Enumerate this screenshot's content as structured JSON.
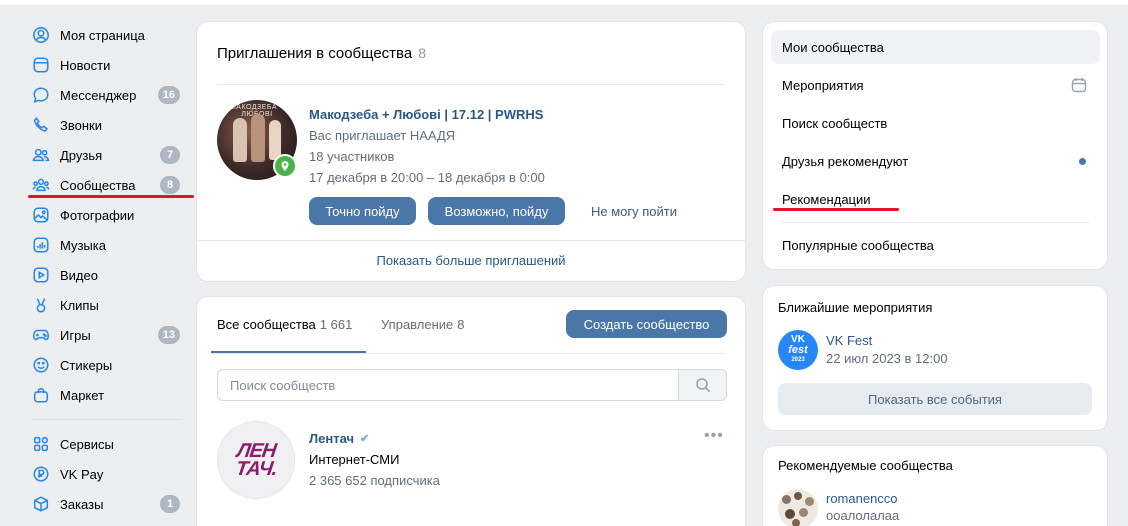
{
  "colors": {
    "accent": "#4a76a8",
    "link": "#2a5885",
    "badge": "#aeb7c2",
    "annotation_red": "#e0142b",
    "page_bg": "#edeef0"
  },
  "nav": {
    "items": [
      {
        "label": "Моя страница",
        "icon": "user-circle-icon"
      },
      {
        "label": "Новости",
        "icon": "news-icon"
      },
      {
        "label": "Мессенджер",
        "icon": "chat-bubble-icon",
        "badge": "16"
      },
      {
        "label": "Звонки",
        "icon": "phone-icon"
      },
      {
        "label": "Друзья",
        "icon": "friends-icon",
        "badge": "7"
      },
      {
        "label": "Сообщества",
        "icon": "communities-icon",
        "badge": "8"
      },
      {
        "label": "Фотографии",
        "icon": "photo-icon"
      },
      {
        "label": "Музыка",
        "icon": "music-icon"
      },
      {
        "label": "Видео",
        "icon": "video-icon"
      },
      {
        "label": "Клипы",
        "icon": "clips-icon"
      },
      {
        "label": "Игры",
        "icon": "gamepad-icon",
        "badge": "13"
      },
      {
        "label": "Стикеры",
        "icon": "smile-icon"
      },
      {
        "label": "Маркет",
        "icon": "bag-icon"
      }
    ],
    "items2": [
      {
        "label": "Сервисы",
        "icon": "services-grid-icon"
      },
      {
        "label": "VK Pay",
        "icon": "vkpay-icon"
      },
      {
        "label": "Заказы",
        "icon": "box-icon",
        "badge": "1"
      }
    ]
  },
  "invitations": {
    "title": "Приглашения в сообщества",
    "count": "8",
    "item": {
      "avatar_caption": "МАКОДЗЕБА + ЛЮБОВІ",
      "name": "Макодзеба + Любові | 17.12 | PWRHS",
      "inviter": "Вас приглашает НААДЯ",
      "members": "18 участников",
      "dates": "17 декабря в 20:00 – 18 декабря в 0:00",
      "btn_going": "Точно пойду",
      "btn_maybe": "Возможно, пойду",
      "btn_cant": "Не могу пойти"
    },
    "show_more": "Показать больше приглашений"
  },
  "communities": {
    "tab_all": "Все сообщества",
    "tab_all_count": "1 661",
    "tab_manage": "Управление",
    "tab_manage_count": "8",
    "create_btn": "Создать сообщество",
    "search_placeholder": "Поиск сообществ",
    "items": [
      {
        "avatar_line1": "ЛЕН",
        "avatar_line2": "ТАЧ.",
        "name": "Лентач",
        "verified": "✔",
        "category": "Интернет-СМИ",
        "subscribers": "2 365 652 подписчика",
        "menu": "•••"
      }
    ]
  },
  "right_menu": {
    "items": [
      {
        "label": "Мои сообщества",
        "active": true
      },
      {
        "label": "Мероприятия",
        "icon": "calendar-icon"
      },
      {
        "label": "Поиск сообществ"
      },
      {
        "label": "Друзья рекомендуют",
        "dot": true
      },
      {
        "label": "Рекомендации"
      },
      {
        "label": "Популярные сообщества"
      }
    ]
  },
  "events": {
    "title": "Ближайшие мероприятия",
    "item": {
      "logo_line1": "VK",
      "logo_line2": "fest",
      "logo_line3": "2023",
      "name": "VK Fest",
      "date": "22 июл 2023 в 12:00"
    },
    "show_all": "Показать все события"
  },
  "recommended": {
    "title": "Рекомендуемые сообщества",
    "item": {
      "name": "romanencco",
      "sub": "ооалолалаа"
    }
  }
}
